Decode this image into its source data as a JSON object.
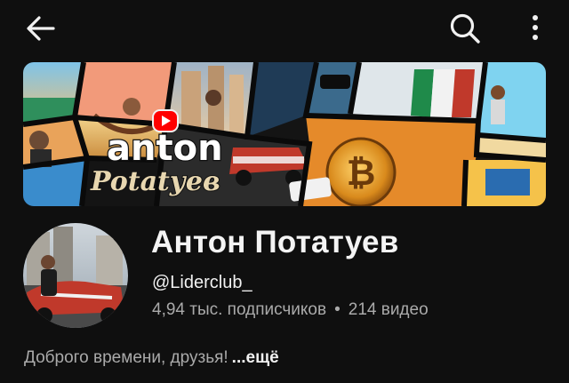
{
  "topbar": {
    "back_icon": "arrow-left-icon",
    "search_icon": "search-icon",
    "more_icon": "more-vertical-icon"
  },
  "banner": {
    "logo_text_line1": "anton",
    "logo_text_line2": "Potatуев",
    "play_icon": "youtube-play-icon"
  },
  "channel": {
    "name": "Антон Потатуев",
    "handle": "@Liderclub_",
    "subscribers": "4,94 тыс. подписчиков",
    "separator": "•",
    "videos": "214 видео"
  },
  "description": {
    "text": "Доброго времени, друзья!",
    "more_label": "...ещё"
  },
  "colors": {
    "background": "#0f0f0f",
    "primary_text": "#f1f1f1",
    "secondary_text": "#aaaaaa",
    "youtube_red": "#ff0000"
  }
}
